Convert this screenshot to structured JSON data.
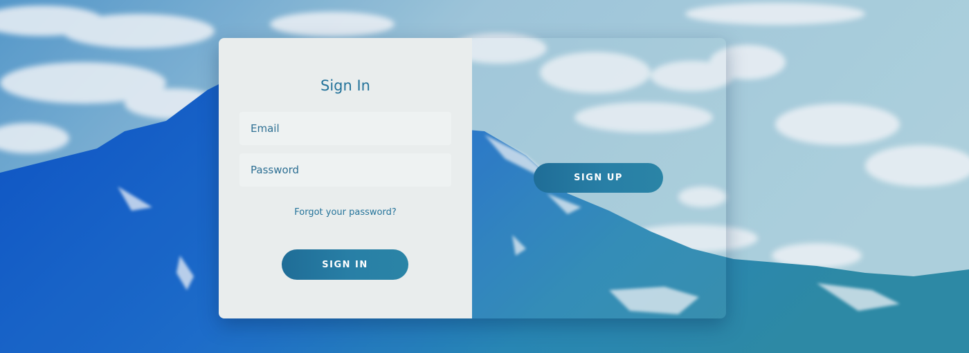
{
  "signin": {
    "title": "Sign In",
    "email_placeholder": "Email",
    "password_placeholder": "Password",
    "forgot_label": "Forgot your password?",
    "signin_button": "SIGN IN"
  },
  "overlay": {
    "signup_button": "SIGN UP"
  },
  "colors": {
    "accent": "#24739a",
    "button_start": "#1f6d97",
    "button_end": "#2a84a6",
    "panel_bg": "#e9eded"
  }
}
